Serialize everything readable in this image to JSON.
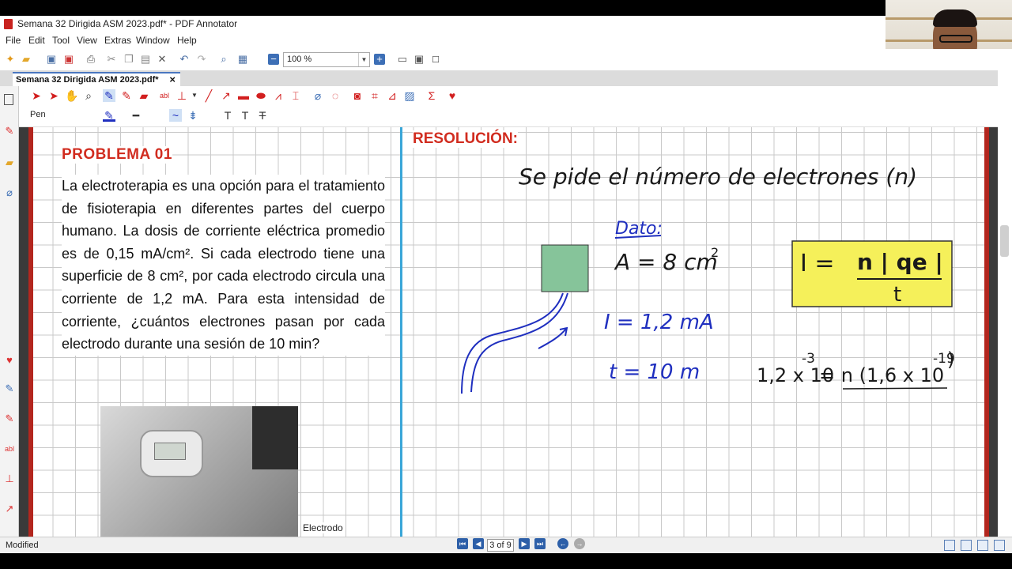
{
  "window": {
    "title": "Semana 32 Dirigida ASM 2023.pdf* - PDF Annotator"
  },
  "menu": [
    "File",
    "Edit",
    "Tool",
    "View",
    "Extras",
    "Window",
    "Help"
  ],
  "toolbar": {
    "zoom": "100 %"
  },
  "tab": {
    "label": "Semana 32 Dirigida ASM 2023.pdf*",
    "close": "×"
  },
  "annotation_toolbar": {
    "current_tool": "Pen"
  },
  "document": {
    "problem_title": "PROBLEMA  01",
    "problem_text": "La electroterapia es una opción para el tratamiento de fisioterapia en diferentes partes del cuerpo humano. La dosis de corriente eléctrica promedio es de 0,15 mA/cm². Si cada electrodo tiene una superficie de 8 cm², por cada electrodo circula una corriente de 1,2 mA. Para esta intensidad de corriente, ¿cuántos electrones pasan por cada electrodo durante una sesión de 10 min?",
    "photo_caption": "Electrodo",
    "resolution_title": "RESOLUCIÓN:",
    "handwriting": {
      "header": "Se pide el número de electrones (n)",
      "datos_label": "Dato:",
      "area": "A = 8 cm",
      "area_exp": "2",
      "current": "I = 1,2 mA",
      "time": "t = 10 m",
      "formula_left": "I =",
      "formula_num": "n | qe |",
      "formula_den": "t",
      "equation_left": "1,2 x 10",
      "equation_left_exp": "-3",
      "equation_right": "= n (1,6 x 10",
      "equation_right_exp": "-19",
      "equation_close": ")"
    }
  },
  "status": {
    "left": "Modified",
    "page_indicator": "3 of 9"
  },
  "colors": {
    "accent_red": "#d12c1f",
    "ink_black": "#1a1a1a",
    "ink_blue": "#1f2fbf",
    "formula_box": "#f5f05a",
    "square_fill": "#86c49a",
    "divider": "#3aa6d8"
  }
}
